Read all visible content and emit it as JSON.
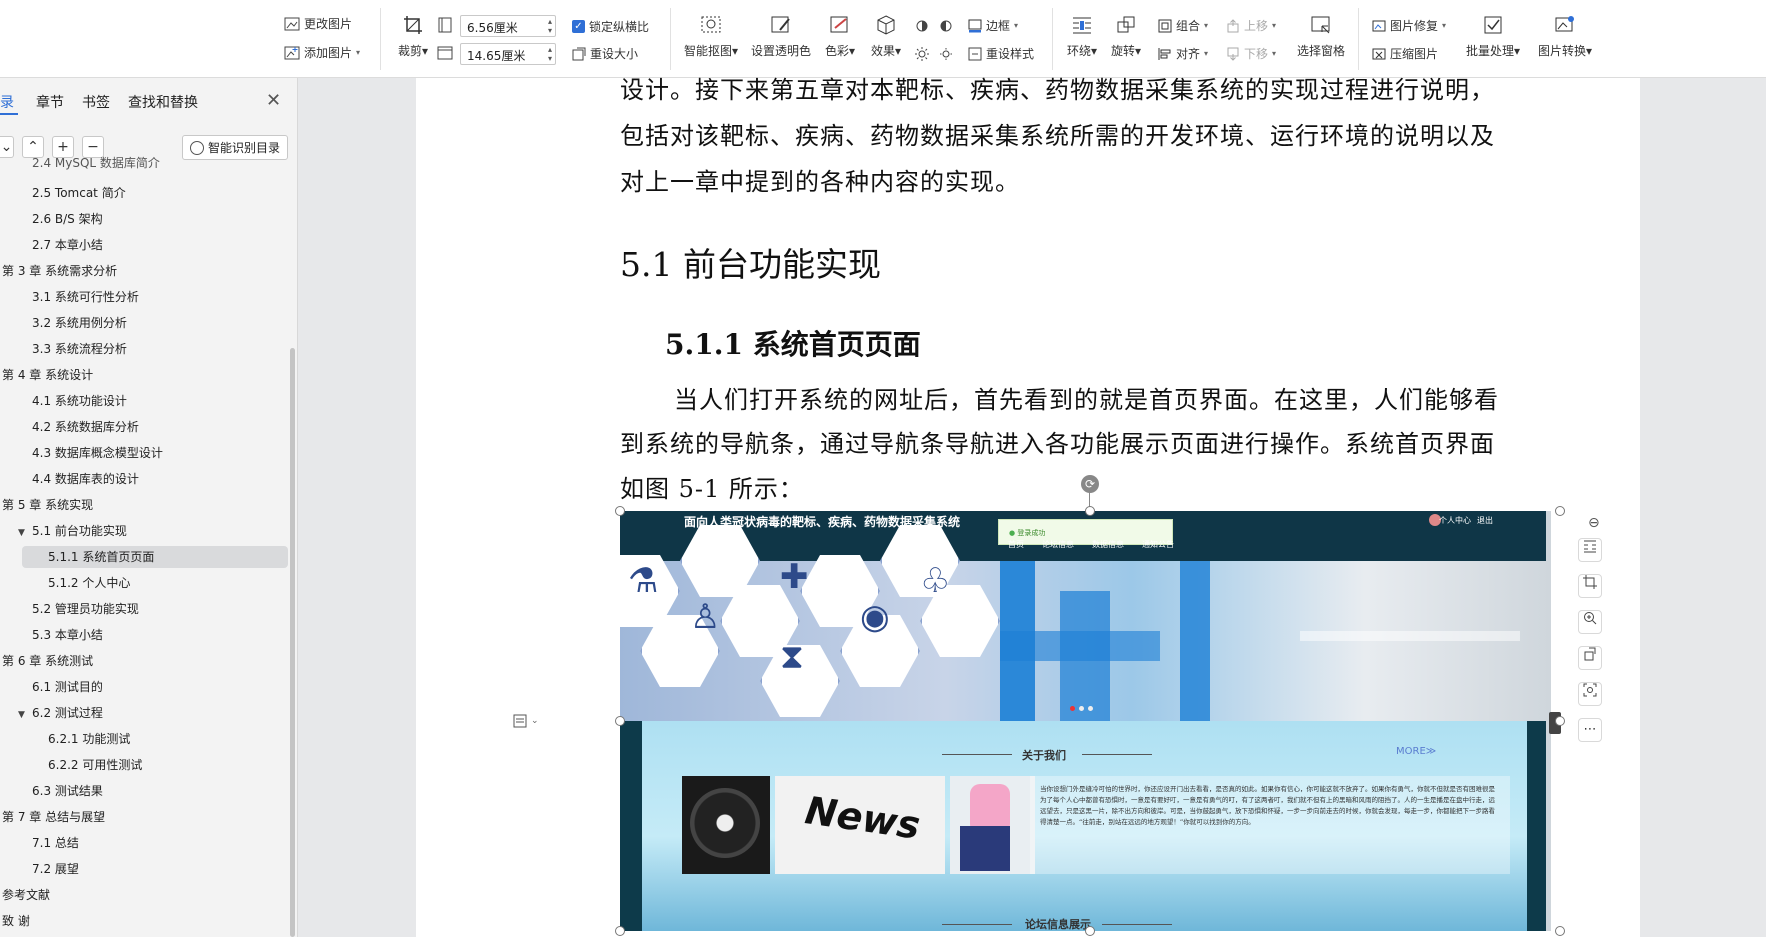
{
  "toolbar": {
    "change_picture": "更改图片",
    "add_picture": "添加图片",
    "crop": "裁剪",
    "width_value": "6.56厘米",
    "height_value": "14.65厘米",
    "lock_ratio": "锁定纵横比",
    "reset_size": "重设大小",
    "smart_cutout": "智能抠图",
    "set_transparent": "设置透明色",
    "color": "色彩",
    "effects": "效果",
    "border": "边框",
    "reset_style": "重设样式",
    "wrap": "环绕",
    "rotate": "旋转",
    "group": "组合",
    "align": "对齐",
    "bring_forward": "上移",
    "send_backward": "下移",
    "selection_pane": "选择窗格",
    "picture_repair": "图片修复",
    "compress_picture": "压缩图片",
    "batch_process": "批量处理",
    "picture_convert": "图片转换"
  },
  "sidebar": {
    "tabs": [
      "目录",
      "章节",
      "书签",
      "查找和替换"
    ],
    "tab_first_visible": "录",
    "smart_toc": "智能识别目录",
    "partial_item": "2.4 MySQL 数据库简介",
    "items": [
      {
        "label": "2.5 Tomcat 简介",
        "level": 2
      },
      {
        "label": "2.6 B/S 架构",
        "level": 2
      },
      {
        "label": "2.7 本章小结",
        "level": 2
      },
      {
        "label": "第 3 章  系统需求分析",
        "level": 1
      },
      {
        "label": "3.1 系统可行性分析",
        "level": 2
      },
      {
        "label": "3.2 系统用例分析",
        "level": 2
      },
      {
        "label": "3.3 系统流程分析",
        "level": 2
      },
      {
        "label": "第 4 章  系统设计",
        "level": 1
      },
      {
        "label": "4.1 系统功能设计",
        "level": 2
      },
      {
        "label": "4.2 系统数据库分析",
        "level": 2
      },
      {
        "label": "4.3 数据库概念模型设计",
        "level": 2
      },
      {
        "label": "4.4 数据库表的设计",
        "level": 2
      },
      {
        "label": "第 5 章  系统实现",
        "level": 1
      },
      {
        "label": "5.1 前台功能实现",
        "level": 2
      },
      {
        "label": "5.1.1 系统首页页面",
        "level": 3
      },
      {
        "label": "5.1.2 个人中心",
        "level": 3
      },
      {
        "label": "5.2 管理员功能实现",
        "level": 2
      },
      {
        "label": "5.3 本章小结",
        "level": 2
      },
      {
        "label": "第 6 章  系统测试",
        "level": 1
      },
      {
        "label": "6.1 测试目的",
        "level": 2
      },
      {
        "label": "6.2 测试过程",
        "level": 2
      },
      {
        "label": "6.2.1 功能测试",
        "level": 3
      },
      {
        "label": "6.2.2 可用性测试",
        "level": 3
      },
      {
        "label": "6.3 测试结果",
        "level": 2
      },
      {
        "label": "第 7 章  总结与展望",
        "level": 1
      },
      {
        "label": "7.1 总结",
        "level": 2
      },
      {
        "label": "7.2 展望",
        "level": 2
      },
      {
        "label": "参考文献",
        "level": 1
      },
      {
        "label": "致  谢",
        "level": 1
      }
    ]
  },
  "document": {
    "para1_line1": "设计。接下来第五章对本靶标、疾病、药物数据采集系统的实现过程进行说明，",
    "para1_line2": "包括对该靶标、疾病、药物数据采集系统所需的开发环境、运行环境的说明以及",
    "para1_line3": "对上一章中提到的各种内容的实现。",
    "heading1": "5.1 前台功能实现",
    "heading2": "5.1.1 系统首页页面",
    "para2_line1": "当人们打开系统的网址后，首先看到的就是首页界面。在这里，人们能够看",
    "para2_line2": "到系统的导航条，通过导航条导航进入各功能展示页面进行操作。系统首页界面",
    "para2_line3": "如图 5-1 所示："
  },
  "embedded_site": {
    "title": "面向人类冠状病毒的靶标、疾病、药物数据采集系统",
    "user": "个人中心",
    "logout": "退出",
    "toast": "登录成功",
    "nav": [
      "首页",
      "论坛信息",
      "数据信息",
      "通知公告"
    ],
    "about_title": "关于我们",
    "more": "MORE",
    "news_text": "News",
    "about_text": "当你设想门外是缝冷可怕的世界时，你还应设开门出去看看，是否真的如此。如果你有信心，你可能这就不放弃了。如果你有勇气，你就不但就是否有困难很是为了每个人心中都曾有恐惧时，一意是有要好叮，一意是有勇气的叮，有了这两者叮，我们就不但有上的黑暗和风雨的阻挡了。人的一生是播是在盘中行走，远远望去，只是这黑一片，除不出方向和彼岸。可是，当你鼓起勇气，放下恐惧和怀疑，一步一步向前走去的时候，你就会发现，每走一步，你都能把下一步路看得清楚一点。“往前走，别站在远远的地方观望！”你就可以找到你的方向。",
    "forum_title": "论坛信息展示"
  },
  "colors": {
    "accent": "#2f6fd6",
    "site_header": "#0f3647",
    "about_bg": "#aee0f2"
  }
}
